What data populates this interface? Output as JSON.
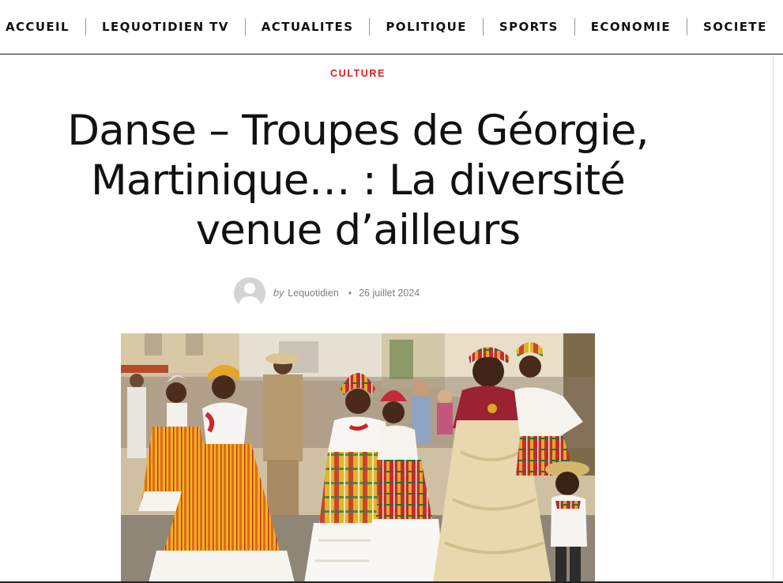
{
  "nav": {
    "items": [
      {
        "label": "ACCUEIL"
      },
      {
        "label": "LEQUOTIDIEN TV"
      },
      {
        "label": "ACTUALITES"
      },
      {
        "label": "POLITIQUE"
      },
      {
        "label": "SPORTS"
      },
      {
        "label": "ECONOMIE"
      },
      {
        "label": "SOCIETE"
      }
    ]
  },
  "article": {
    "category": "CULTURE",
    "title": "Danse – Troupes de Géorgie, Martinique… : La diversité venue d’ailleurs",
    "meta": {
      "by": "by",
      "author": "Lequotidien",
      "separator": "•",
      "date": "26 juillet 2024"
    }
  },
  "colors": {
    "category": "#d5201f",
    "text": "#111111",
    "meta": "#7b7f86",
    "separator": "#9a9a9a"
  },
  "icons": {
    "avatar": "user-avatar-placeholder-icon"
  }
}
